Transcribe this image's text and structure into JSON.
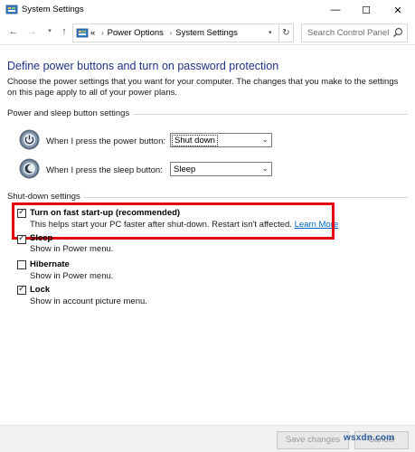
{
  "window": {
    "title": "System Settings",
    "minimize_glyph": "—",
    "maximize_glyph": "☐",
    "close_glyph": "✕"
  },
  "nav": {
    "back_glyph": "←",
    "forward_glyph": "→",
    "recent_glyph": "▾",
    "up_glyph": "↑",
    "breadcrumb_prefix": "«",
    "breadcrumbs": [
      "Power Options",
      "System Settings"
    ],
    "breadcrumb_separator": "›",
    "address_dropdown_glyph": "▾",
    "refresh_glyph": "↻",
    "search_placeholder": "Search Control Panel"
  },
  "page": {
    "heading": "Define power buttons and turn on password protection",
    "description": "Choose the power settings that you want for your computer. The changes that you make to the settings on this page apply to all of your power plans."
  },
  "power_section": {
    "label": "Power and sleep button settings",
    "rows": [
      {
        "label": "When I press the power button:",
        "value": "Shut down",
        "icon": "power-button-icon"
      },
      {
        "label": "When I press the sleep button:",
        "value": "Sleep",
        "icon": "sleep-button-icon"
      }
    ],
    "dropdown_glyph": "⌄"
  },
  "shutdown_section": {
    "label": "Shut-down settings",
    "check_glyph": "✓",
    "options": [
      {
        "label": "Turn on fast start-up (recommended)",
        "description": "This helps start your PC faster after shut-down. Restart isn't affected.",
        "link": "Learn More",
        "checked": true
      },
      {
        "label": "Sleep",
        "description": "Show in Power menu.",
        "checked": true
      },
      {
        "label": "Hibernate",
        "description": "Show in Power menu.",
        "checked": false
      },
      {
        "label": "Lock",
        "description": "Show in account picture menu.",
        "checked": true
      }
    ]
  },
  "footer": {
    "save_label": "Save changes",
    "cancel_label": "Cancel",
    "watermark": "wsxdn.com"
  },
  "colors": {
    "heading": "#1e3287",
    "highlight_border": "#e3000f",
    "link": "#0066cc"
  }
}
